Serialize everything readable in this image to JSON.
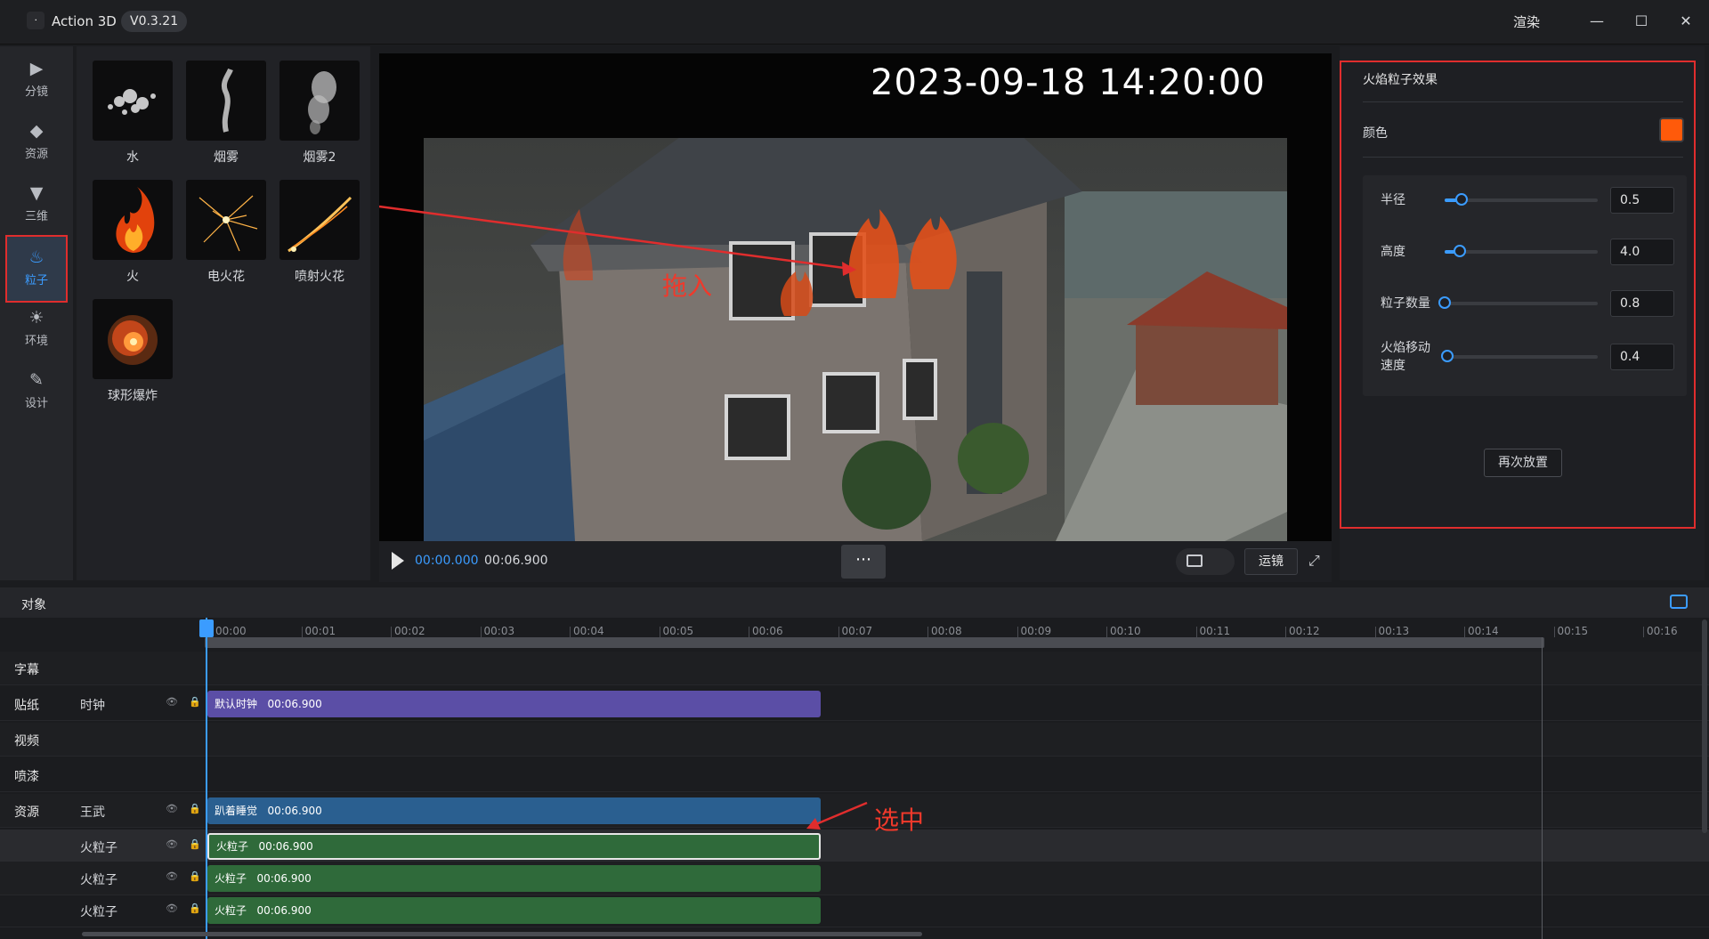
{
  "titlebar": {
    "logo_glyph": "ᐧ",
    "app_name": "Action 3D",
    "version": "V0.3.21",
    "render_label": "渲染",
    "minimize_glyph": "—",
    "maximize_glyph": "☐",
    "close_glyph": "✕"
  },
  "nav": {
    "items": [
      {
        "label": "分镜",
        "icon": "storyboard-icon",
        "glyph": "▶"
      },
      {
        "label": "资源",
        "icon": "cube-icon",
        "glyph": "◆"
      },
      {
        "label": "三维",
        "icon": "download-box-icon",
        "glyph": "▼"
      },
      {
        "label": "粒子",
        "icon": "flame-icon",
        "glyph": "♨",
        "active": true
      },
      {
        "label": "环境",
        "icon": "sun-cloud-icon",
        "glyph": "☀"
      },
      {
        "label": "设计",
        "icon": "design-tools-icon",
        "glyph": "✎"
      }
    ]
  },
  "assets": {
    "items": [
      {
        "label": "水"
      },
      {
        "label": "烟雾"
      },
      {
        "label": "烟雾2"
      },
      {
        "label": "火"
      },
      {
        "label": "电火花"
      },
      {
        "label": "喷射火花"
      },
      {
        "label": "球形爆炸"
      }
    ]
  },
  "viewport": {
    "timestamp": "2023-09-18  14:20:00",
    "annotation_drag": "拖入"
  },
  "playback": {
    "current_time": "00:00.000",
    "total_time": "00:06.900",
    "more_glyph": "⋯",
    "camera_label": "运镜",
    "fullscreen_glyph": "⤢"
  },
  "props": {
    "title": "火焰粒子效果",
    "color_label": "颜色",
    "color_value": "#ff5a0a",
    "params": [
      {
        "label": "半径",
        "value": "0.5",
        "level": 0.11
      },
      {
        "label": "高度",
        "value": "4.0",
        "level": 0.1
      },
      {
        "label": "粒子数量",
        "value": "0.8",
        "level": 0.0
      },
      {
        "label": "火焰移动速度",
        "label_lines": [
          "火焰移动",
          "速度"
        ],
        "value": "0.4",
        "level": 0.02
      }
    ],
    "again_label": "再次放置",
    "accent": "#3b9cff"
  },
  "timeline": {
    "title": "对象",
    "ticks": [
      "00:00",
      "00:01",
      "00:02",
      "00:03",
      "00:04",
      "00:05",
      "00:06",
      "00:07",
      "00:08",
      "00:09",
      "00:10",
      "00:11",
      "00:12",
      "00:13",
      "00:14",
      "00:15",
      "00:16"
    ],
    "rows": [
      {
        "category": "字幕",
        "name": "",
        "clip": null
      },
      {
        "category": "贴纸",
        "name": "时钟",
        "clip": {
          "label": "默认时钟",
          "duration": "00:06.900",
          "color": "purple"
        }
      },
      {
        "category": "视频",
        "name": "",
        "clip": null
      },
      {
        "category": "喷漆",
        "name": "",
        "clip": null
      },
      {
        "category": "资源",
        "name": "王武",
        "clip": {
          "label": "趴着睡觉",
          "duration": "00:06.900",
          "color": "blue"
        }
      },
      {
        "category": "",
        "name": "火粒子",
        "clip": {
          "label": "火粒子",
          "duration": "00:06.900",
          "color": "green",
          "selected": true
        }
      },
      {
        "category": "",
        "name": "火粒子",
        "clip": {
          "label": "火粒子",
          "duration": "00:06.900",
          "color": "green"
        }
      },
      {
        "category": "",
        "name": "火粒子",
        "clip": {
          "label": "火粒子",
          "duration": "00:06.900",
          "color": "green"
        }
      }
    ],
    "annotation_select": "选中"
  }
}
